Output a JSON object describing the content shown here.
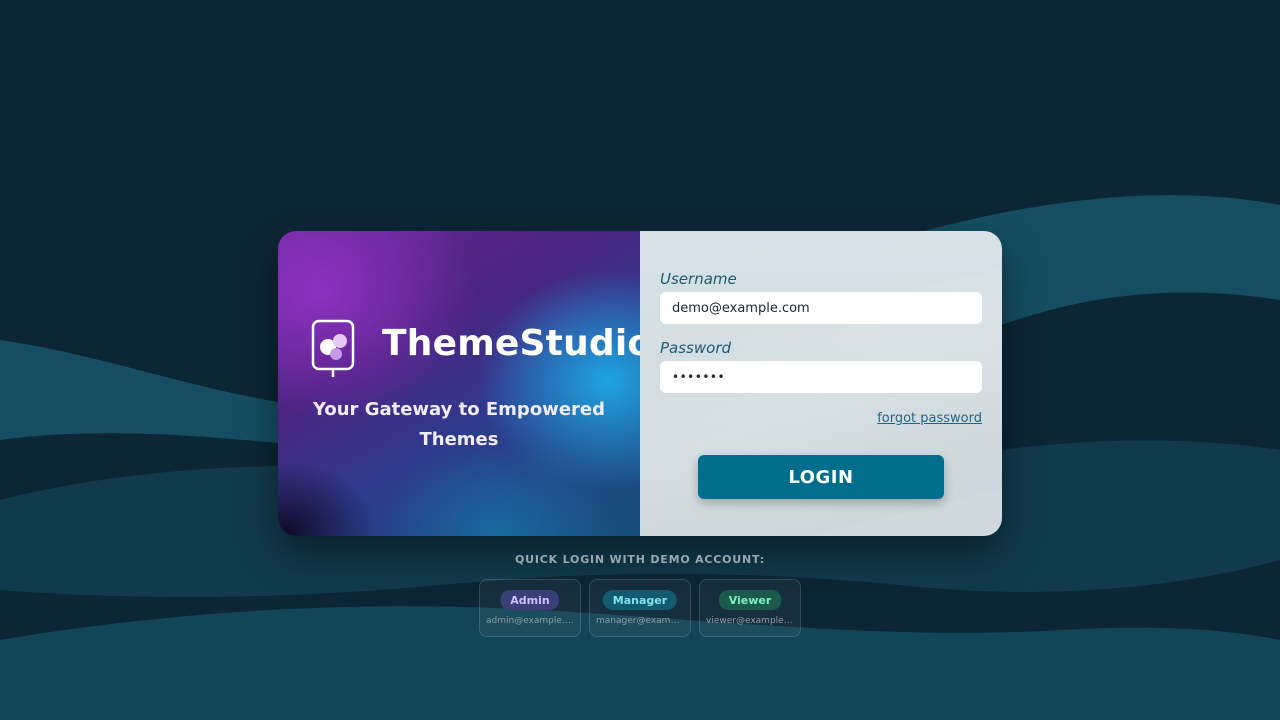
{
  "brand": {
    "name": "ThemeStudio",
    "tagline": "Your Gateway to Empowered Themes",
    "logo_icon": "palette-sign-icon"
  },
  "login_form": {
    "username_label": "Username",
    "username_value": "demo@example.com",
    "password_label": "Password",
    "password_value": "•••••••",
    "forgot_password_label": "forgot password",
    "login_button_label": "LOGIN"
  },
  "quick_login": {
    "title": "QUICK LOGIN WITH DEMO ACCOUNT:",
    "accounts": [
      {
        "role": "Admin",
        "email": "admin@example.com",
        "badge_bg": "#3b3f78",
        "badge_fg": "#c9c3ff"
      },
      {
        "role": "Manager",
        "email": "manager@example.com",
        "badge_bg": "#135a6e",
        "badge_fg": "#7fe3f5"
      },
      {
        "role": "Viewer",
        "email": "viewer@example.com",
        "badge_bg": "#1b5a4c",
        "badge_fg": "#7ff0c1"
      }
    ]
  },
  "colors": {
    "page_background": "#0d2636",
    "wave_color": "#17566b",
    "accent": "#006e8c",
    "form_background": "#d3dde2"
  }
}
